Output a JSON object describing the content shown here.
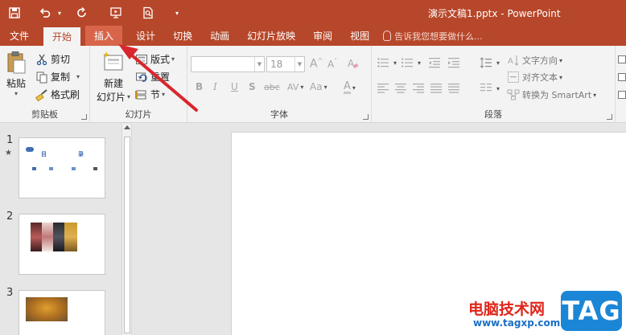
{
  "window": {
    "title": "演示文稿1.pptx - PowerPoint"
  },
  "qat": {
    "undo_caret": "▾",
    "customize": "▾"
  },
  "tabs": [
    {
      "label": "文件"
    },
    {
      "label": "开始"
    },
    {
      "label": "插入"
    },
    {
      "label": "设计"
    },
    {
      "label": "切换"
    },
    {
      "label": "动画"
    },
    {
      "label": "幻灯片放映"
    },
    {
      "label": "审阅"
    },
    {
      "label": "视图"
    }
  ],
  "tell_me": {
    "placeholder": "告诉我您想要做什么..."
  },
  "ribbon": {
    "clipboard": {
      "label": "剪贴板",
      "paste": "粘贴",
      "cut": "剪切",
      "copy": "复制",
      "format_painter": "格式刷"
    },
    "slides": {
      "label": "幻灯片",
      "new_slide_line1": "新建",
      "new_slide_line2": "幻灯片",
      "layout": "版式",
      "reset": "重置",
      "section": "节"
    },
    "font": {
      "label": "字体",
      "font_name": "",
      "font_size": "18",
      "bold": "B",
      "italic": "I",
      "underline": "U",
      "shadow": "S",
      "strike": "abc",
      "spacing": "AV",
      "case": "Aa",
      "color": "A"
    },
    "paragraph": {
      "label": "段落",
      "text_direction": "文字方向",
      "align_text": "对齐文本",
      "smartart": "转换为 SmartArt"
    }
  },
  "slides": [
    {
      "number": "1",
      "marker": "★",
      "title": "目",
      "title2": "录"
    },
    {
      "number": "2"
    },
    {
      "number": "3"
    }
  ],
  "watermark": {
    "site_name": "电脑技术网",
    "url": "www.tagxp.com",
    "logo": "TAG"
  },
  "colors": {
    "accent": "#b7472a",
    "ribbon_bg": "#f3f3f3",
    "workspace_bg": "#e6e6e6",
    "arrow": "#d9262c"
  }
}
